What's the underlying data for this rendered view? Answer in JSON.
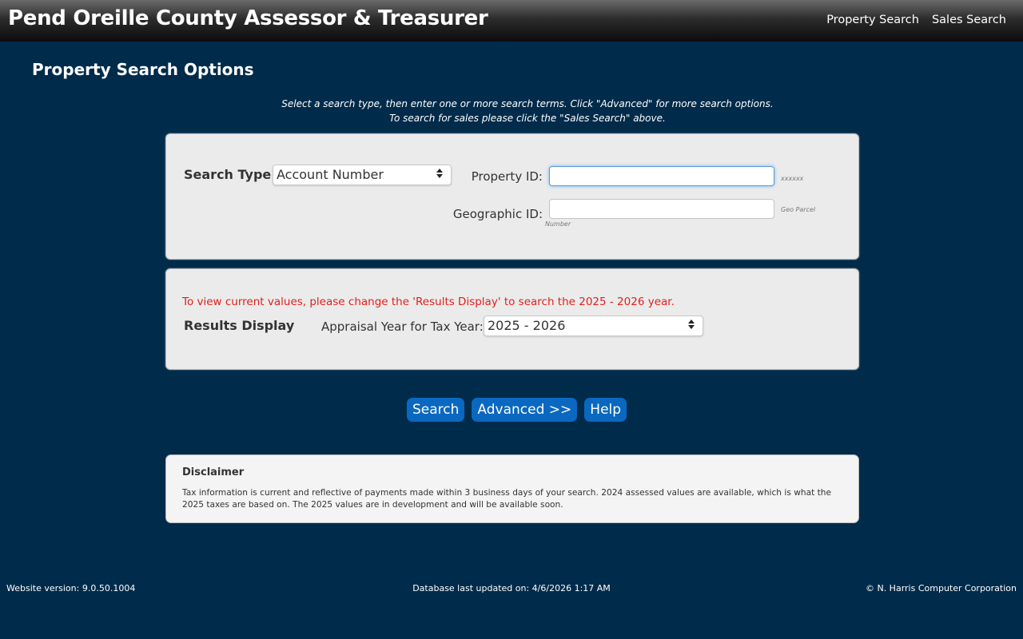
{
  "header": {
    "title": "Pend Oreille County Assessor & Treasurer",
    "nav": [
      "Property Search",
      "Sales Search"
    ]
  },
  "page": {
    "heading": "Property Search Options",
    "instructions": [
      "Select a search type, then enter one or more search terms. Click \"Advanced\" for more search options.",
      "To search for sales please click the \"Sales Search\" above."
    ]
  },
  "search_panel": {
    "search_type_label": "Search Type:",
    "search_type_value": "Account Number",
    "property_id_label": "Property ID:",
    "property_id_value": "",
    "property_id_hint": "xxxxxx",
    "geographic_id_label": "Geographic ID:",
    "geographic_id_value": "",
    "geographic_id_hint_1": "Geo Parcel",
    "geographic_id_hint_2": "Number"
  },
  "results_panel": {
    "notice": "To view current values, please change the 'Results Display' to search the 2025 - 2026 year.",
    "label": "Results Display",
    "appraisal_label": "Appraisal Year for Tax Year:",
    "appraisal_value": "2025 - 2026"
  },
  "buttons": {
    "search": "Search",
    "advanced": "Advanced >>",
    "help": "Help"
  },
  "disclaimer": {
    "title": "Disclaimer",
    "body": "Tax information is current and reflective of payments made within 3 business days of your search. 2024 assessed values are available, which is what the 2025 taxes are based on. The 2025 values are in development and will be available soon."
  },
  "footer": {
    "version": "Website version: 9.0.50.1004",
    "db_updated": "Database last updated on: 4/6/2026 1:17 AM",
    "copyright": "© N. Harris Computer Corporation"
  },
  "colors": {
    "page_bg": "#012b4b",
    "button_bg": "#0a68c0",
    "notice_red": "#e0201b"
  },
  "icons": {
    "select_arrow": "sort-arrows-icon"
  }
}
